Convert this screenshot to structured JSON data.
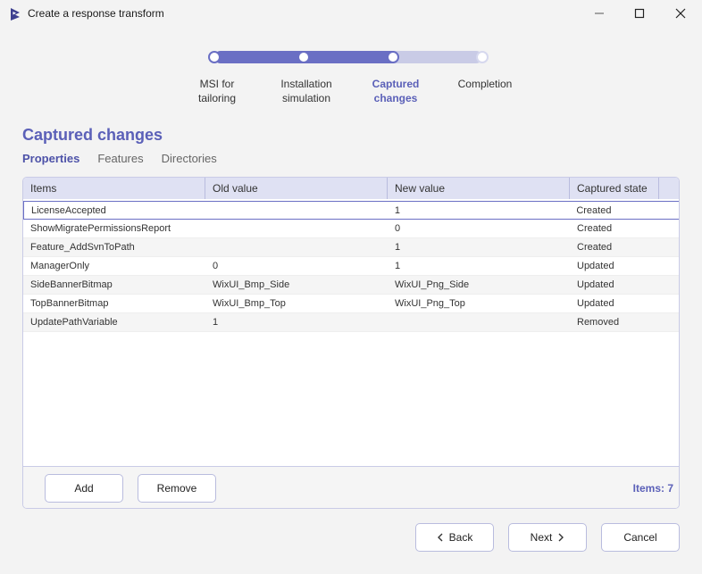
{
  "window": {
    "title": "Create a response transform"
  },
  "stepper": {
    "steps": [
      {
        "label": "MSI for\ntailoring"
      },
      {
        "label": "Installation\nsimulation"
      },
      {
        "label": "Captured\nchanges"
      },
      {
        "label": "Completion"
      }
    ],
    "current_step": 3,
    "progress": 0.67
  },
  "page": {
    "heading": "Captured changes",
    "tabs": [
      "Properties",
      "Features",
      "Directories"
    ],
    "active_tab": "Properties"
  },
  "table": {
    "columns": [
      "Items",
      "Old value",
      "New value",
      "Captured state"
    ],
    "rows": [
      {
        "item": "LicenseAccepted",
        "old": "",
        "new": "1",
        "state": "Created"
      },
      {
        "item": "ShowMigratePermissionsReport",
        "old": "",
        "new": "0",
        "state": "Created"
      },
      {
        "item": "Feature_AddSvnToPath",
        "old": "",
        "new": "1",
        "state": "Created"
      },
      {
        "item": "ManagerOnly",
        "old": "0",
        "new": "1",
        "state": "Updated"
      },
      {
        "item": "SideBannerBitmap",
        "old": "WixUI_Bmp_Side",
        "new": "WixUI_Png_Side",
        "state": "Updated"
      },
      {
        "item": "TopBannerBitmap",
        "old": "WixUI_Bmp_Top",
        "new": "WixUI_Png_Top",
        "state": "Updated"
      },
      {
        "item": "UpdatePathVariable",
        "old": "1",
        "new": "",
        "state": "Removed"
      }
    ],
    "selected_row": 0
  },
  "panel_footer": {
    "add_label": "Add",
    "remove_label": "Remove",
    "items_count": "Items: 7"
  },
  "footer": {
    "back_label": "Back",
    "next_label": "Next",
    "cancel_label": "Cancel"
  },
  "colors": {
    "accent": "#5b60b8",
    "progress_fill": "#6a6fc4",
    "progress_track": "#c9cbe6"
  }
}
